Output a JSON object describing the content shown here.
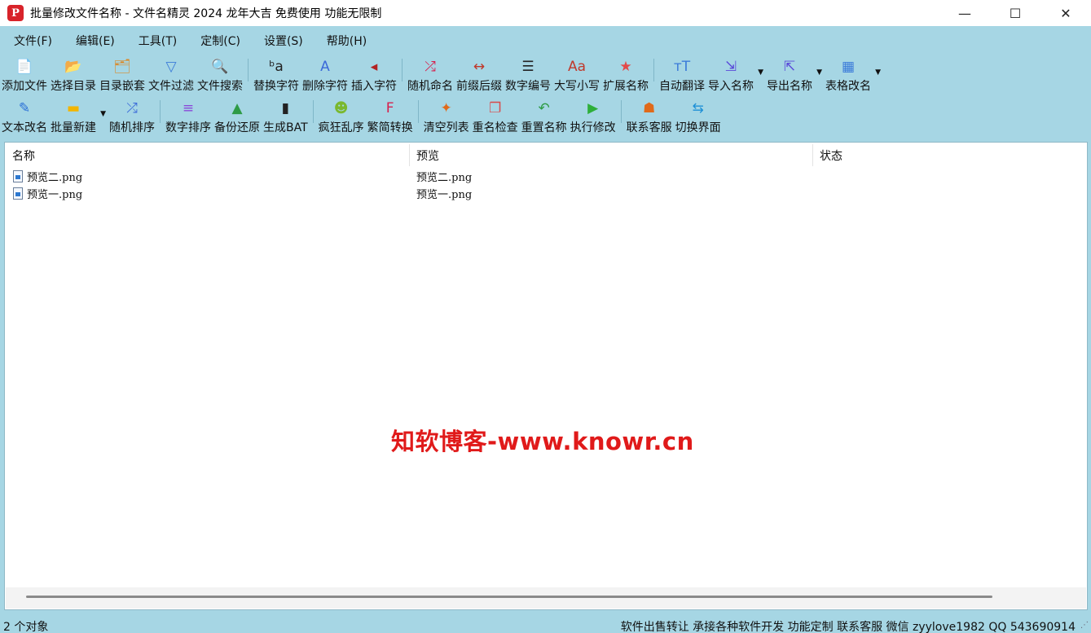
{
  "window": {
    "title": "批量修改文件名称 - 文件名精灵 2024 龙年大吉 免费使用 功能无限制",
    "app_icon_glyph": "P",
    "minimize_glyph": "—",
    "maximize_glyph": "☐",
    "close_glyph": "✕"
  },
  "menu": [
    "文件(F)",
    "编辑(E)",
    "工具(T)",
    "定制(C)",
    "设置(S)",
    "帮助(H)"
  ],
  "toolbar1": [
    {
      "label": "添加文件",
      "icon": "add-file-icon",
      "glyph": "📄",
      "color": "#4a9a3c"
    },
    {
      "label": "选择目录",
      "icon": "open-folder-icon",
      "glyph": "📂",
      "color": "#e3a21a"
    },
    {
      "label": "目录嵌套",
      "icon": "nested-folder-icon",
      "glyph": "🗂",
      "color": "#d98a2b"
    },
    {
      "label": "文件过滤",
      "icon": "filter-icon",
      "glyph": "▽",
      "color": "#3b7bd9"
    },
    {
      "label": "文件搜索",
      "icon": "search-icon",
      "glyph": "🔍",
      "color": "#555555"
    },
    {
      "label": "替换字符",
      "icon": "replace-text-icon",
      "glyph": "ᵇa",
      "color": "#222222"
    },
    {
      "label": "删除字符",
      "icon": "delete-text-icon",
      "glyph": "A",
      "color": "#3b6ad9"
    },
    {
      "label": "插入字符",
      "icon": "insert-text-icon",
      "glyph": "◂",
      "color": "#b22222"
    },
    {
      "label": "随机命名",
      "icon": "shuffle-icon",
      "glyph": "⤮",
      "color": "#d6204d"
    },
    {
      "label": "前缀后缀",
      "icon": "prefix-suffix-icon",
      "glyph": "↔",
      "color": "#c0392b"
    },
    {
      "label": "数字编号",
      "icon": "numbered-list-icon",
      "glyph": "☰",
      "color": "#222222"
    },
    {
      "label": "大写小写",
      "icon": "case-icon",
      "glyph": "Aa",
      "color": "#c0392b"
    },
    {
      "label": "扩展名称",
      "icon": "star-icon",
      "glyph": "★",
      "color": "#e24a4a"
    },
    {
      "label": "自动翻译",
      "icon": "translate-icon",
      "glyph": "ᴛT",
      "color": "#3b7bd9"
    },
    {
      "label": "导入名称",
      "icon": "import-icon",
      "glyph": "⇲",
      "color": "#5a4ad9",
      "dropdown": true
    },
    {
      "label": "导出名称",
      "icon": "export-icon",
      "glyph": "⇱",
      "color": "#5a4ad9",
      "dropdown": true
    },
    {
      "label": "表格改名",
      "icon": "table-icon",
      "glyph": "▦",
      "color": "#3b7bd9",
      "dropdown": true
    }
  ],
  "toolbar2": [
    {
      "label": "文本改名",
      "icon": "edit-text-icon",
      "glyph": "✎",
      "color": "#2a6fd6"
    },
    {
      "label": "批量新建",
      "icon": "new-folder-icon",
      "glyph": "▬",
      "color": "#f2b500",
      "dropdown": true
    },
    {
      "label": "随机排序",
      "icon": "random-sort-icon",
      "glyph": "⤮",
      "color": "#3b6ad9"
    },
    {
      "label": "数字排序",
      "icon": "number-sort-icon",
      "glyph": "≡",
      "color": "#8a4ad9"
    },
    {
      "label": "备份还原",
      "icon": "backup-icon",
      "glyph": "▲",
      "color": "#2e9b46"
    },
    {
      "label": "生成BAT",
      "icon": "terminal-icon",
      "glyph": "▮",
      "color": "#222222"
    },
    {
      "label": "疯狂乱序",
      "icon": "crazy-shuffle-icon",
      "glyph": "☻",
      "color": "#7ab82e"
    },
    {
      "label": "繁简转换",
      "icon": "convert-icon",
      "glyph": "F",
      "color": "#d6204d"
    },
    {
      "label": "清空列表",
      "icon": "broom-icon",
      "glyph": "✦",
      "color": "#e06a1a"
    },
    {
      "label": "重名检查",
      "icon": "duplicate-check-icon",
      "glyph": "❐",
      "color": "#d94a4a"
    },
    {
      "label": "重置名称",
      "icon": "undo-icon",
      "glyph": "↶",
      "color": "#2e9b46"
    },
    {
      "label": "执行修改",
      "icon": "play-icon",
      "glyph": "▶",
      "color": "#2eaf3a"
    },
    {
      "label": "联系客服",
      "icon": "support-icon",
      "glyph": "☗",
      "color": "#e06a1a"
    },
    {
      "label": "切换界面",
      "icon": "switch-ui-icon",
      "glyph": "⇆",
      "color": "#1e90d6"
    }
  ],
  "list": {
    "columns": [
      "名称",
      "预览",
      "状态"
    ],
    "rows": [
      {
        "name": "预览二.png",
        "preview": "预览二.png",
        "status": ""
      },
      {
        "name": "预览一.png",
        "preview": "预览一.png",
        "status": ""
      }
    ]
  },
  "watermark": "知软博客-www.knowr.cn",
  "status": {
    "left": "2 个对象",
    "right": "软件出售转让 承接各种软件开发 功能定制 联系客服 微信 zyylove1982 QQ 543690914"
  }
}
